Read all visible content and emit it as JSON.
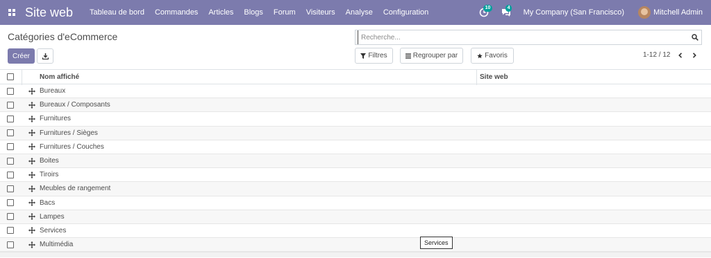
{
  "navbar": {
    "app_name": "Site web",
    "menu": [
      "Tableau de bord",
      "Commandes",
      "Articles",
      "Blogs",
      "Forum",
      "Visiteurs",
      "Analyse",
      "Configuration"
    ],
    "activity_count": "10",
    "message_count": "4",
    "company": "My Company (San Francisco)",
    "user": "Mitchell Admin",
    "color": "#7c7bad",
    "badge_color": "#00a09d"
  },
  "control_panel": {
    "title": "Catégories d'eCommerce",
    "create_label": "Créer",
    "search_placeholder": "Recherche...",
    "filters_label": "Filtres",
    "groupby_label": "Regrouper par",
    "favorites_label": "Favoris",
    "pager": "1-12 / 12"
  },
  "table": {
    "columns": [
      "Nom affiché",
      "Site web"
    ],
    "rows": [
      {
        "name": "Bureaux",
        "website": ""
      },
      {
        "name": "Bureaux / Composants",
        "website": ""
      },
      {
        "name": "Furnitures",
        "website": ""
      },
      {
        "name": "Furnitures / Sièges",
        "website": ""
      },
      {
        "name": "Furnitures / Couches",
        "website": ""
      },
      {
        "name": "Boites",
        "website": ""
      },
      {
        "name": "Tiroirs",
        "website": ""
      },
      {
        "name": "Meubles de rangement",
        "website": ""
      },
      {
        "name": "Bacs",
        "website": ""
      },
      {
        "name": "Lampes",
        "website": ""
      },
      {
        "name": "Services",
        "website": ""
      },
      {
        "name": "Multimédia",
        "website": ""
      }
    ]
  },
  "tooltip": "Services"
}
